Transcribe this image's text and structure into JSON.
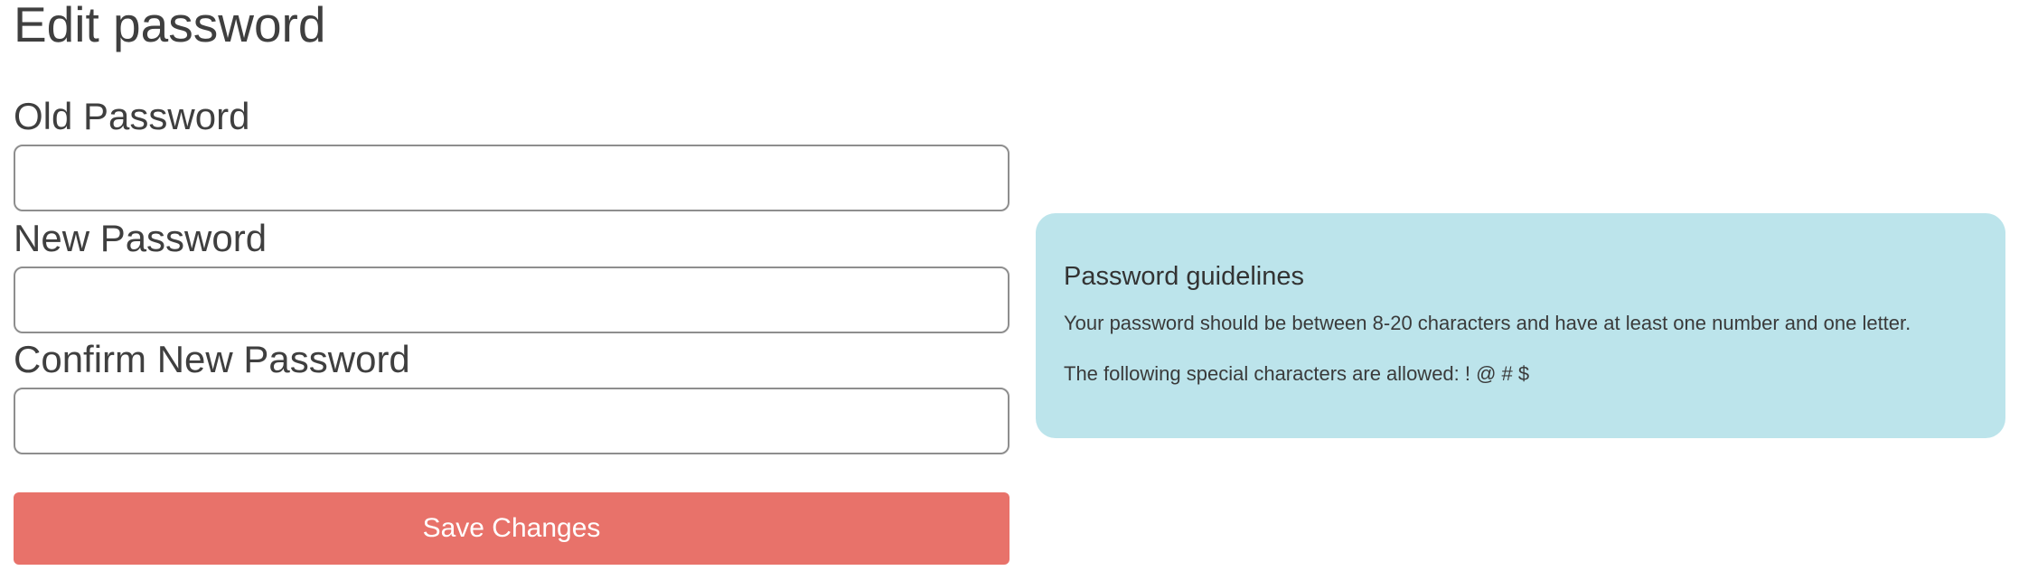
{
  "page": {
    "title": "Edit password"
  },
  "form": {
    "old_password": {
      "label": "Old Password",
      "value": "",
      "placeholder": ""
    },
    "new_password": {
      "label": "New Password",
      "value": "",
      "placeholder": ""
    },
    "confirm_password": {
      "label": "Confirm New Password",
      "value": "",
      "placeholder": ""
    },
    "save_label": "Save Changes"
  },
  "guidelines": {
    "title": "Password guidelines",
    "rule_length": "Your password should be between 8-20 characters and have at least one number and one letter.",
    "rule_special": "The following special characters are allowed: ! @ # $"
  },
  "colors": {
    "save_button": "#e8726a",
    "guidelines_background": "#bce4eb",
    "text": "#3f3f3f",
    "input_border": "#8e8e8e"
  }
}
